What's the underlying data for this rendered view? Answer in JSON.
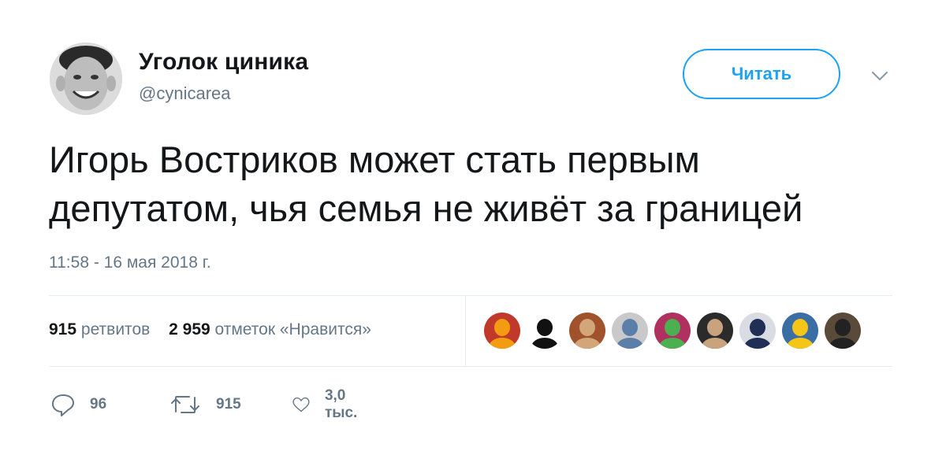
{
  "author": {
    "display_name": "Уголок циника",
    "handle": "@cynicarea",
    "avatar_icon": "avatar-smiling-man-icon"
  },
  "follow_button": {
    "label": "Читать"
  },
  "menu": {
    "icon": "chevron-down-icon"
  },
  "tweet": {
    "text_lines": [
      "Игорь Востриков может стать первым",
      "депутатом, чья семья не живёт за границей"
    ],
    "timestamp": "11:58 - 16 мая 2018 г."
  },
  "stats": {
    "retweets_count": "915",
    "retweets_label": "ретвитов",
    "likes_count": "2 959",
    "likes_label": "отметок «Нравится»"
  },
  "likers": [
    {
      "icon": "liker-avatar-1",
      "bg": "#c0392b",
      "fg": "#f39c12"
    },
    {
      "icon": "liker-avatar-2",
      "bg": "#ffffff",
      "fg": "#111111"
    },
    {
      "icon": "liker-avatar-3",
      "bg": "#a0522d",
      "fg": "#d2a679"
    },
    {
      "icon": "liker-avatar-4",
      "bg": "#c9c9c9",
      "fg": "#5b7fa8"
    },
    {
      "icon": "liker-avatar-5",
      "bg": "#b03060",
      "fg": "#4caf50"
    },
    {
      "icon": "liker-avatar-6",
      "bg": "#2b2b2b",
      "fg": "#c8a37e"
    },
    {
      "icon": "liker-avatar-7",
      "bg": "#d9dde3",
      "fg": "#1f2f55"
    },
    {
      "icon": "liker-avatar-8",
      "bg": "#3a6ea5",
      "fg": "#f5c518"
    },
    {
      "icon": "liker-avatar-9",
      "bg": "#5a4a3a",
      "fg": "#222222"
    }
  ],
  "actions": {
    "reply_count": "96",
    "retweet_count": "915",
    "like_count": "3,0 тыс."
  },
  "colors": {
    "accent": "#1da1f2",
    "secondary_text": "#657786",
    "primary_text": "#14171a",
    "divider": "#e6ecf0"
  }
}
